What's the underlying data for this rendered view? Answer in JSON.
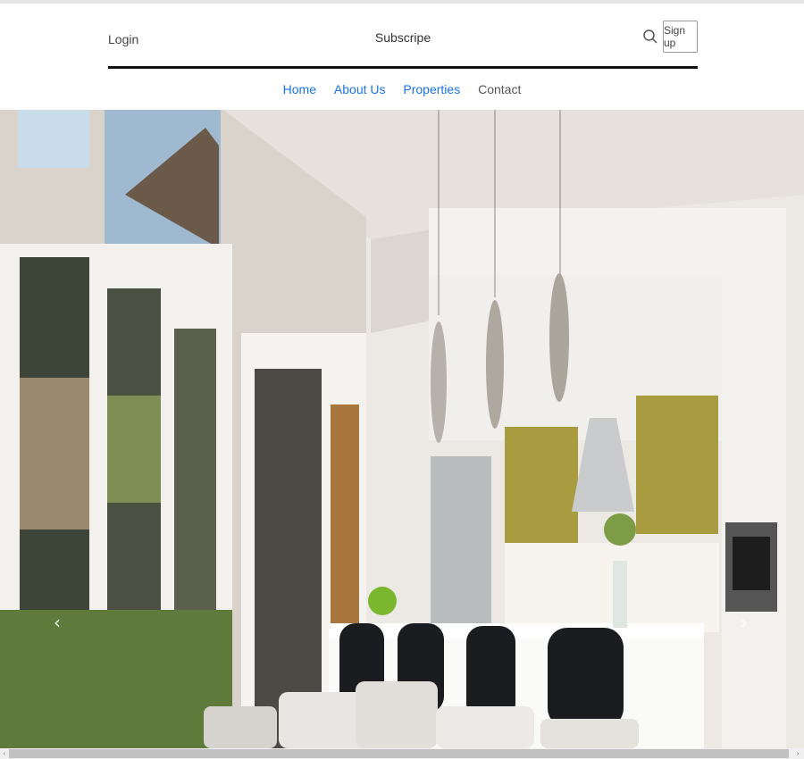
{
  "header": {
    "login_label": "Login",
    "subscribe_label": "Subscripe",
    "signup_label": "Sign up",
    "search_icon": "search-icon"
  },
  "nav": {
    "items": [
      {
        "label": "Home",
        "active": true
      },
      {
        "label": "About Us",
        "active": true
      },
      {
        "label": "Properties",
        "active": true
      },
      {
        "label": "Contact",
        "active": false
      }
    ]
  },
  "carousel": {
    "prev_icon": "chevron-left-icon",
    "next_icon": "chevron-right-icon",
    "prev_glyph": "‹",
    "next_glyph": "›"
  },
  "scrollbar": {
    "left_glyph": "‹",
    "right_glyph": "›"
  },
  "colors": {
    "link": "#1a73e8",
    "rule": "#111111"
  }
}
